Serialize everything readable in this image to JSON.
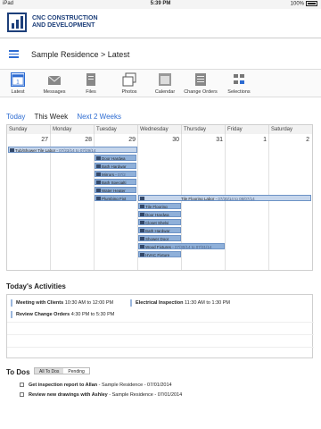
{
  "status": {
    "carrier": "iPad",
    "time": "5:39 PM",
    "battery": "100%"
  },
  "company": {
    "line1": "CNC CONSTRUCTION",
    "line2": "AND DEVELOPMENT"
  },
  "breadcrumb": "Sample Residence > Latest",
  "toolbar": [
    {
      "label": "Latest",
      "icon": "calendar-1-icon",
      "active": true
    },
    {
      "label": "Messages",
      "icon": "messages-icon"
    },
    {
      "label": "Files",
      "icon": "files-icon"
    },
    {
      "label": "Photos",
      "icon": "photos-icon"
    },
    {
      "label": "Calendar",
      "icon": "calendar-icon"
    },
    {
      "label": "Change Orders",
      "icon": "change-orders-icon"
    },
    {
      "label": "Selections",
      "icon": "selections-icon"
    }
  ],
  "calendar_tabs": {
    "today": "Today",
    "this_week": "This Week",
    "next_2_weeks": "Next 2 Weeks"
  },
  "days": [
    {
      "name": "Sunday",
      "num": "27"
    },
    {
      "name": "Monday",
      "num": "28"
    },
    {
      "name": "Tuesday",
      "num": "29"
    },
    {
      "name": "Wednesday",
      "num": "30"
    },
    {
      "name": "Thursday",
      "num": "31"
    },
    {
      "name": "Friday",
      "num": "1"
    },
    {
      "name": "Saturday",
      "num": "2"
    }
  ],
  "events": {
    "tub_shower": {
      "title": "Tub/Shower Tile Labor",
      "dates": "07/23/14 to 07/29/14"
    },
    "door_hardware": {
      "title": "Door Hardwa"
    },
    "bath_hardware": {
      "title": "Bath Hardwar"
    },
    "mirrors": {
      "title": "Mirrors",
      "dates": "07/2"
    },
    "bath_specialty": {
      "title": "Bath Specialti"
    },
    "water_heater": {
      "title": "Water Heater"
    },
    "plumbing_fixtures": {
      "title": "Plumbing Fixt"
    },
    "tile_flooring_labor": {
      "title": "Tile Flooring Labor",
      "dates": "07/30/14 to 08/07/14"
    },
    "tile_flooring": {
      "title": "Tile Flooring"
    },
    "door_hardware2": {
      "title": "Door Hardwa"
    },
    "closet_shelving": {
      "title": "Closet Shelvi"
    },
    "bath_hardware2": {
      "title": "Bath Hardwar"
    },
    "shower_door": {
      "title": "Shower Door"
    },
    "wood_fixtures": {
      "title": "Wood Fixtures",
      "dates": "07/30/14 to 07/31/14"
    },
    "hvac_fixtures": {
      "title": "HVAC Fixture"
    }
  },
  "activities": {
    "title": "Today's Activities",
    "items": [
      {
        "title": "Meeting with Clients",
        "time": "10:30 AM to 12:00 PM"
      },
      {
        "title": "Electrical Inspection",
        "time": "11:30 AM to 1:30 PM"
      },
      {
        "title": "Review Change Orders",
        "time": "4:30 PM to 5:30 PM"
      }
    ]
  },
  "todos": {
    "title": "To Dos",
    "filters": {
      "all": "All To Dos",
      "pending": "Pending"
    },
    "items": [
      {
        "title": "Get inspection report to Allan",
        "meta": "- Sample Residence - 07/01/2014"
      },
      {
        "title": "Review new drawings with Ashley",
        "meta": "- Sample Residence - 07/01/2014"
      }
    ]
  }
}
